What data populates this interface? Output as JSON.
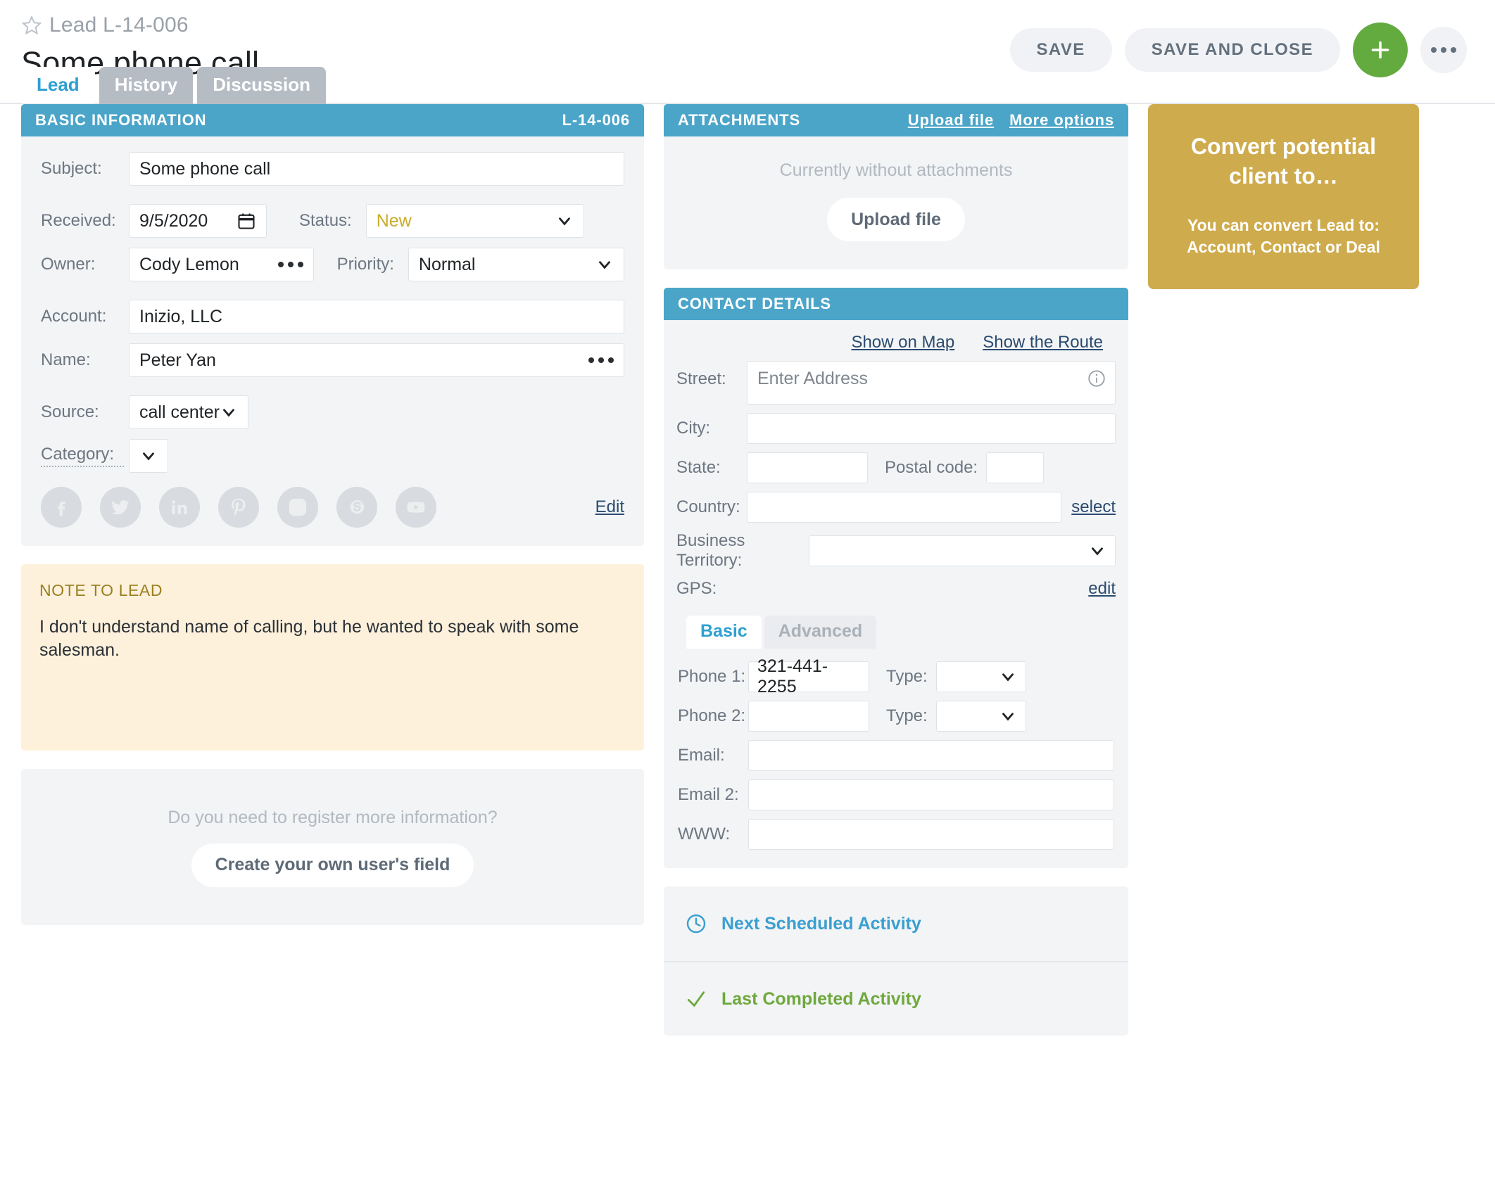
{
  "header": {
    "breadcrumb": "Lead L-14-006",
    "title": "Some phone call",
    "star_icon": "star-outline-icon",
    "buttons": {
      "save": "SAVE",
      "save_and_close": "SAVE AND CLOSE",
      "add_icon": "plus-icon",
      "more_icon": "ellipsis-icon"
    }
  },
  "tabs": [
    {
      "label": "Lead",
      "active": true
    },
    {
      "label": "History",
      "active": false
    },
    {
      "label": "Discussion",
      "active": false
    }
  ],
  "basic_information": {
    "title": "BASIC INFORMATION",
    "record_id": "L-14-006",
    "fields": {
      "subject_label": "Subject:",
      "subject_value": "Some phone call",
      "received_label": "Received:",
      "received_value": "9/5/2020",
      "status_label": "Status:",
      "status_value": "New",
      "owner_label": "Owner:",
      "owner_value": "Cody Lemon",
      "priority_label": "Priority:",
      "priority_value": "Normal",
      "account_label": "Account:",
      "account_value": "Inizio, LLC",
      "name_label": "Name:",
      "name_value": "Peter Yan",
      "source_label": "Source:",
      "source_value": "call center",
      "category_label": "Category:",
      "category_value": ""
    },
    "social": [
      "facebook-icon",
      "twitter-icon",
      "linkedin-icon",
      "pinterest-icon",
      "instagram-icon",
      "skype-icon",
      "youtube-icon"
    ],
    "edit_link": "Edit"
  },
  "note": {
    "title": "NOTE TO LEAD",
    "body": "I don't understand name of calling, but he wanted to speak with some salesman."
  },
  "user_field": {
    "hint": "Do you need to register more information?",
    "button": "Create your own user's field"
  },
  "attachments": {
    "title": "ATTACHMENTS",
    "upload_link": "Upload file",
    "more_options_link": "More options",
    "empty_text": "Currently without attachments",
    "upload_button": "Upload file"
  },
  "contact_details": {
    "title": "CONTACT DETAILS",
    "show_on_map": "Show on Map",
    "show_the_route": "Show the Route",
    "street_label": "Street:",
    "street_placeholder": "Enter Address",
    "street_value": "",
    "info_icon": "info-icon",
    "city_label": "City:",
    "city_value": "",
    "state_label": "State:",
    "state_value": "",
    "postal_label": "Postal code:",
    "postal_value": "",
    "country_label": "Country:",
    "country_value": "",
    "country_select_link": "select",
    "territory_label": "Business Territory:",
    "territory_value": "",
    "gps_label": "GPS:",
    "gps_edit_link": "edit",
    "subtabs": [
      {
        "label": "Basic",
        "active": true
      },
      {
        "label": "Advanced",
        "active": false
      }
    ],
    "phone1_label": "Phone 1:",
    "phone1_value": "321-441-2255",
    "phone1_type_label": "Type:",
    "phone1_type_value": "",
    "phone2_label": "Phone 2:",
    "phone2_value": "",
    "phone2_type_label": "Type:",
    "phone2_type_value": "",
    "email_label": "Email:",
    "email_value": "",
    "email2_label": "Email 2:",
    "email2_value": "",
    "www_label": "WWW:",
    "www_value": ""
  },
  "activities": {
    "next_icon": "clock-icon",
    "next_label": "Next Scheduled Activity",
    "last_icon": "check-icon",
    "last_label": "Last Completed Activity"
  },
  "convert": {
    "title": "Convert potential client to…",
    "subtitle": "You can convert Lead to: Account, Contact or Deal"
  },
  "colors": {
    "panel_header": "#4ba5c9",
    "accent_blue": "#2e9fd0",
    "convert_gold": "#ceab4d",
    "note_bg": "#fdf1dc",
    "status_new": "#c9ac2b",
    "add_green": "#63aa3f",
    "activity_green": "#6fa83d"
  }
}
